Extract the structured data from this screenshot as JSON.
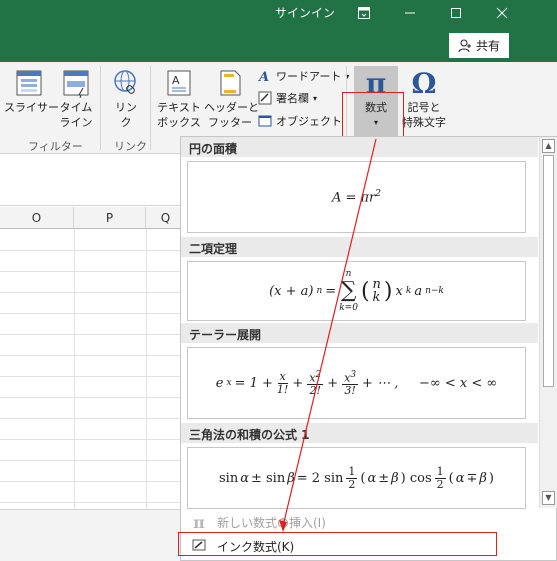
{
  "titlebar": {
    "signin": "サインイン",
    "share": "共有",
    "restore_icon": "ribbon-display-icon",
    "minimize_icon": "minimize-icon",
    "maximize_icon": "maximize-icon",
    "close_icon": "close-icon",
    "bg_color": "#217346"
  },
  "ribbon": {
    "slicer_label": "スライサー",
    "timeline_label": "タイム\nライン",
    "filter_group": "フィルター",
    "link_label": "リン\nク",
    "link_group": "リンク",
    "textbox_label": "テキスト\nボックス",
    "header_footer_label": "ヘッダーと\nフッター",
    "wordart_label": "ワードアート",
    "signature_label": "署名欄",
    "object_label": "オブジェクト",
    "equation_label": "数式",
    "symbol_label": "記号と\n特殊文字"
  },
  "sheet": {
    "columns": [
      "O",
      "P",
      "Q"
    ]
  },
  "gallery": {
    "categories": [
      {
        "label": "円の面積",
        "equation": "A = πr²"
      },
      {
        "label": "二項定理",
        "equation": "(x + a)ⁿ = Σ (n k) xᵏaⁿ⁻ᵏ"
      },
      {
        "label": "テーラー展開",
        "equation": "eˣ = 1 + x/1! + x²/2! + x³/3! + ⋯ , −∞ < x < ∞"
      },
      {
        "label": "三角法の和積の公式 1",
        "equation": "sin α ± sin β = 2 sin ½(α ± β) cos ½(α ∓ β)"
      }
    ],
    "menu": {
      "insert_new": "新しい数式の挿入(I)",
      "ink_equation": "インク数式(K)"
    }
  }
}
